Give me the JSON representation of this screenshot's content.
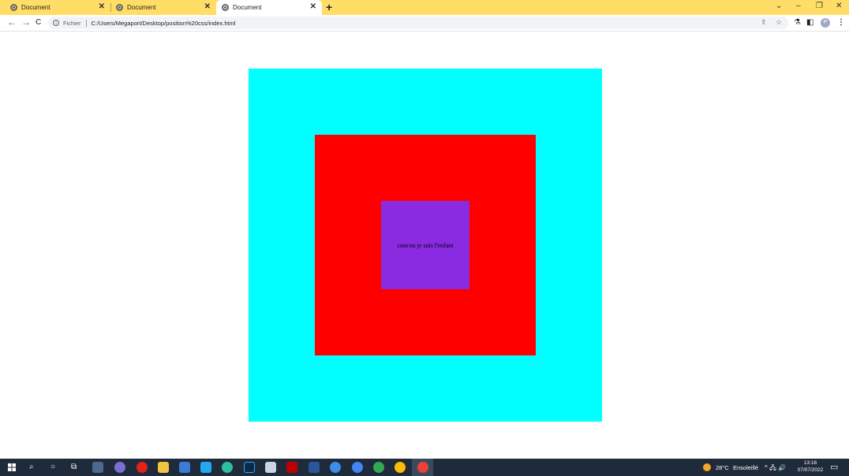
{
  "browser": {
    "tabs": [
      {
        "title": "Document",
        "close": "✕"
      },
      {
        "title": "Document",
        "close": "✕"
      },
      {
        "title": "Document",
        "close": "✕"
      }
    ],
    "new_tab": "+",
    "window_controls": {
      "chevron": "⌄",
      "minimize": "–",
      "restore": "❐",
      "close": "✕"
    },
    "nav": {
      "back": "←",
      "forward": "→",
      "reload": "C"
    },
    "address": {
      "scheme_label": "Fichier",
      "url": "C:/Users/Megaport/Desktop/position%20css/index.html",
      "info": "i"
    },
    "toolbar_icons": {
      "share": "⇪",
      "bookmark": "☆",
      "extensions": "⚗",
      "sidepanel": "◧",
      "profile": "P",
      "menu": "⋮"
    }
  },
  "page": {
    "child_text": "coucou je suis l'enfant",
    "colors": {
      "parent": "#00ffff",
      "middle": "#ff0000",
      "child": "#8a2be2"
    }
  },
  "taskbar": {
    "start_icon": "windows-icon",
    "search_icon": "⌕",
    "cortana_icon": "○",
    "taskview_icon": "⧉",
    "apps": [
      "app",
      "chrome-icon",
      "opera-icon",
      "file-explorer-icon",
      "photos-icon",
      "vscode-icon",
      "edge-icon",
      "photoshop-icon",
      "notepad-icon",
      "filezilla-icon",
      "word-icon",
      "app",
      "chrome-icon",
      "chrome-icon",
      "chrome-icon",
      "chrome-icon"
    ],
    "weather": {
      "temp": "28°C",
      "condition": "Ensoleillé"
    },
    "tray_icons": "^ 🖧 🔊",
    "time": "13:16",
    "date": "07/07/2022",
    "notification_icon": "▭"
  }
}
